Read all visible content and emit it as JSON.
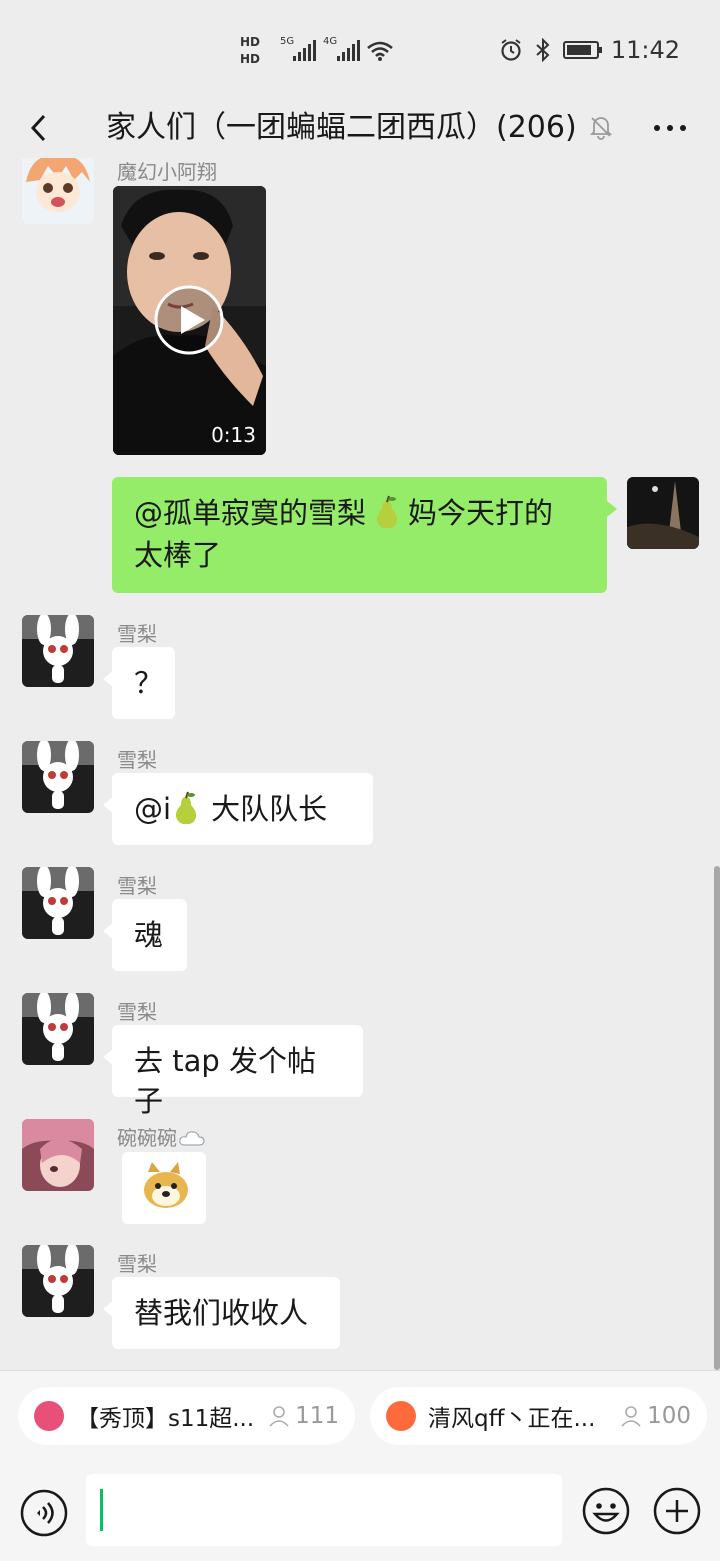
{
  "status_bar": {
    "hd1": "HD",
    "hd2": "HD",
    "net1": "5G",
    "net2": "4G",
    "time": "11:42"
  },
  "header": {
    "title": "家人们（一团蝙蝠二团西瓜）(206)"
  },
  "chat": {
    "partial_sender": "魔幻小阿翔",
    "video": {
      "duration": "0:13"
    },
    "outgoing": {
      "mention": "@孤单寂寞的雪梨",
      "text_after_emoji": "妈今天打的",
      "line2": "太棒了"
    },
    "messages": [
      {
        "sender": "雪梨",
        "text": "？"
      },
      {
        "sender": "雪梨",
        "prefix": "@i",
        "text": "大队队长"
      },
      {
        "sender": "雪梨",
        "text": "魂"
      },
      {
        "sender": "雪梨",
        "text": "去 tap 发个帖子"
      },
      {
        "sender": "碗碗碗",
        "text": ""
      },
      {
        "sender": "雪梨",
        "text": "替我们收收人"
      }
    ]
  },
  "live_pills": [
    {
      "text": "【秀顶】s11超...",
      "count": "111",
      "icon_color": "#e8507a"
    },
    {
      "text": "清风qff丶正在...",
      "count": "100",
      "icon_color": "#ff6a3d"
    }
  ],
  "input": {
    "placeholder": ""
  },
  "colors": {
    "accent_green": "#95ec69",
    "background": "#ededed",
    "caret": "#07c160"
  }
}
